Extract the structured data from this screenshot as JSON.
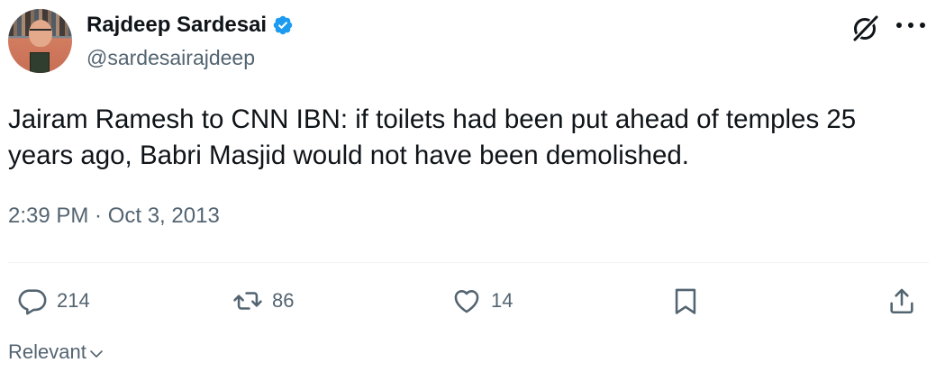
{
  "author": {
    "name": "Rajdeep Sardesai",
    "handle": "@sardesairajdeep",
    "verified": true
  },
  "tweet": {
    "text": "Jairam Ramesh to CNN IBN: if toilets had been put ahead of temples 25\nyears ago, Babri Masjid would not have been demolished.",
    "timestamp": "2:39 PM · Oct 3, 2013"
  },
  "actions": {
    "replies": "214",
    "reposts": "86",
    "likes": "14"
  },
  "sort": {
    "label": "Relevant"
  },
  "colors": {
    "text": "#0f1419",
    "secondary": "#536471",
    "verified": "#1d9bf0",
    "divider": "#eff3f4"
  },
  "icons": [
    "grok-icon",
    "more-icon",
    "verified-badge-icon",
    "reply-icon",
    "repost-icon",
    "like-icon",
    "bookmark-icon",
    "share-icon",
    "chevron-down-icon"
  ]
}
